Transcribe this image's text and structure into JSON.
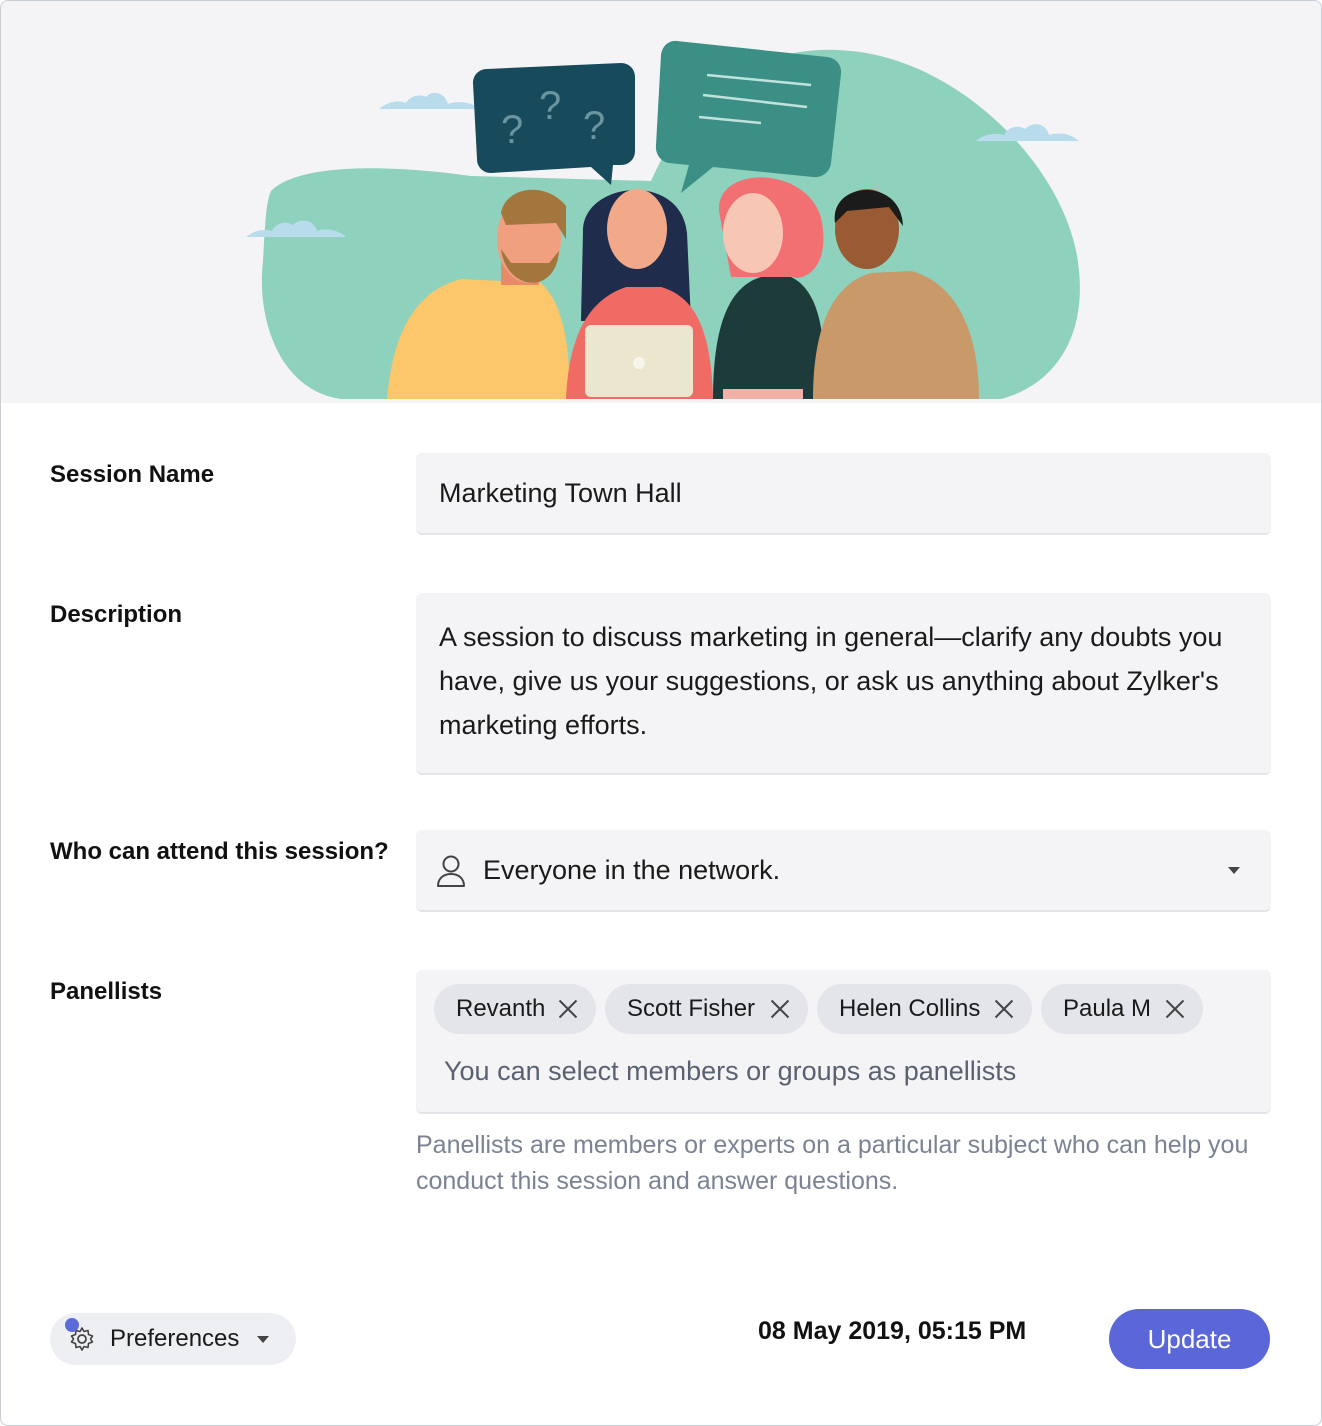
{
  "form": {
    "session_name": {
      "label": "Session Name",
      "value": "Marketing Town Hall"
    },
    "description": {
      "label": "Description",
      "value": "A session to discuss marketing in general—clarify any doubts you have, give us your suggestions, or ask us anything about Zylker's marketing efforts."
    },
    "attendance": {
      "label": "Who can attend this session?",
      "value": "Everyone in the network.",
      "icon": "person-icon"
    },
    "panellists": {
      "label": "Panellists",
      "chips": [
        {
          "label": "Revanth"
        },
        {
          "label": "Scott Fisher"
        },
        {
          "label": "Helen Collins"
        },
        {
          "label": "Paula M"
        }
      ],
      "placeholder": "You can select members or groups as panellists",
      "hint": "Panellists are members or experts on a particular subject who can help you conduct this session and answer questions."
    }
  },
  "footer": {
    "preferences_label": "Preferences",
    "datetime": "08 May 2019, 05:15 PM",
    "update_label": "Update"
  },
  "colors": {
    "accent": "#5b66d8",
    "hero_bg": "#f4f4f6",
    "field_bg": "#f4f4f6",
    "blob": "#8ed1bd"
  }
}
